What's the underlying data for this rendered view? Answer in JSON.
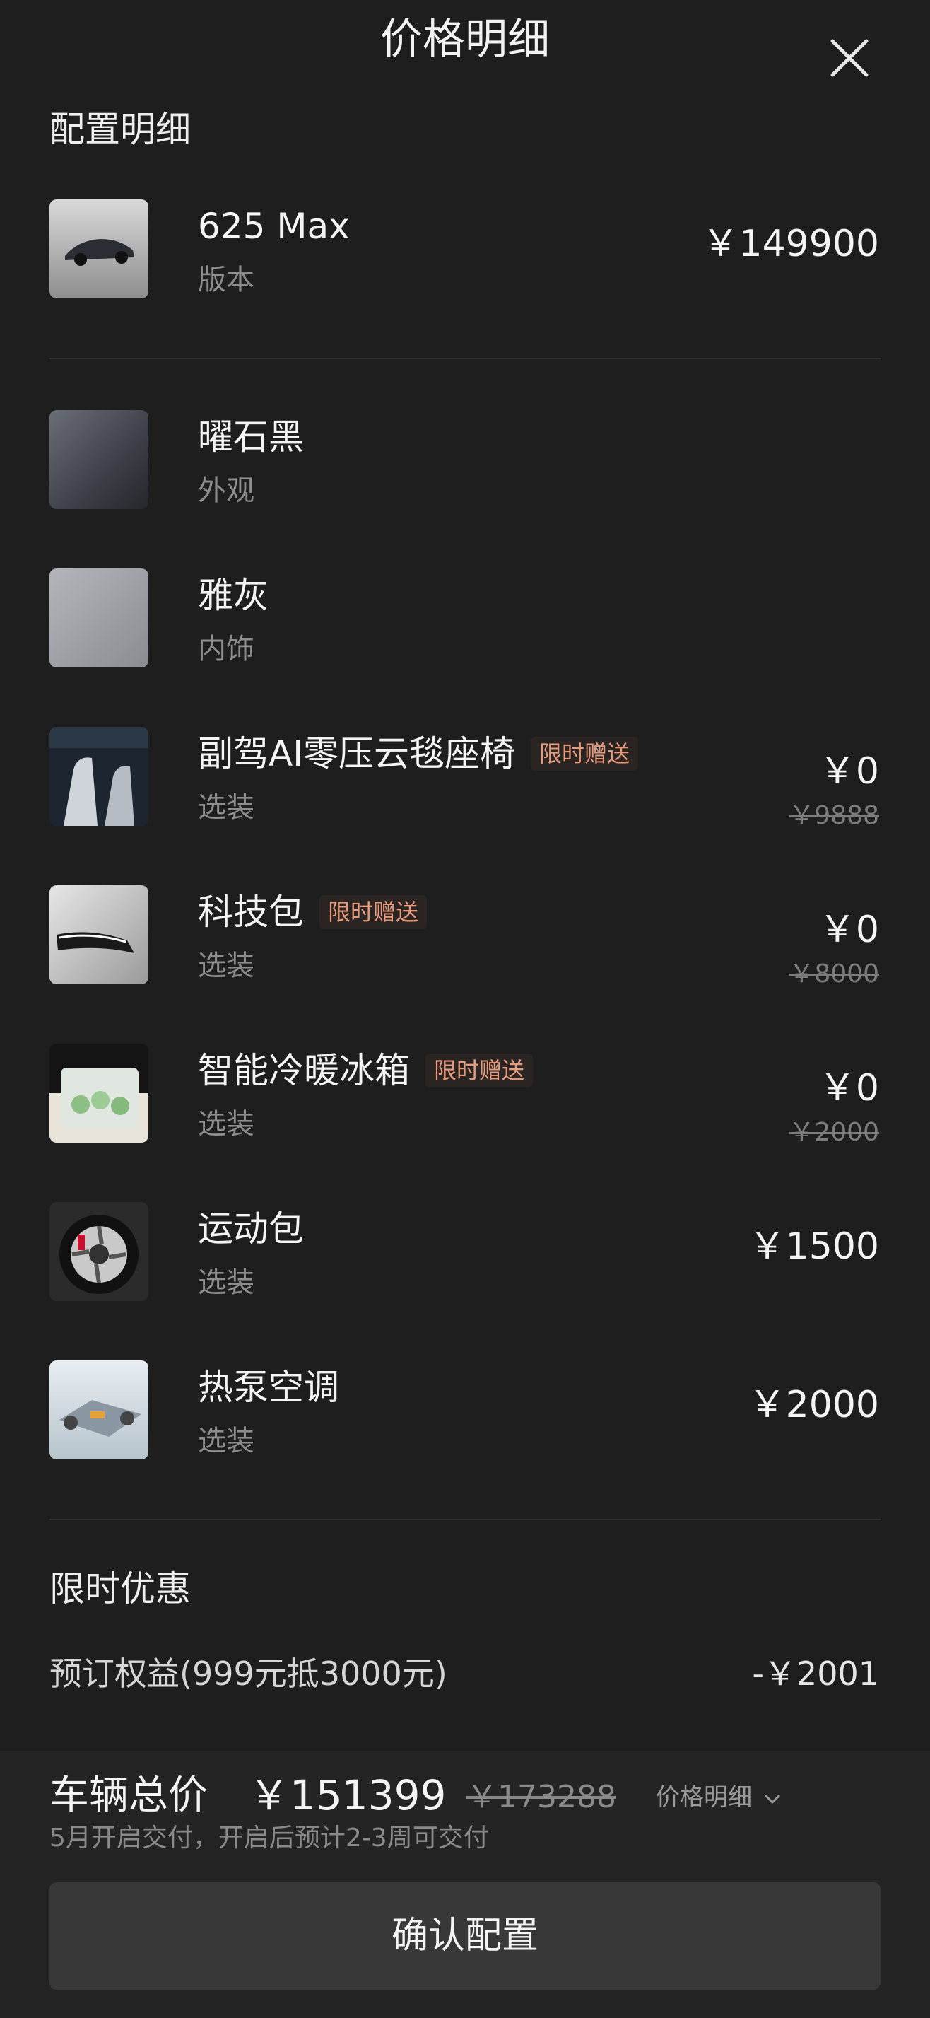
{
  "header": {
    "title": "价格明细",
    "close_icon": "close-icon"
  },
  "config": {
    "section_title": "配置明细",
    "version": {
      "name": "625 Max",
      "category": "版本",
      "price": "￥149900",
      "thumb_icon": "car-thumbnail"
    },
    "items": [
      {
        "name": "曜石黑",
        "category": "外观",
        "thumb_icon": "exterior-color-swatch"
      },
      {
        "name": "雅灰",
        "category": "内饰",
        "thumb_icon": "interior-color-swatch"
      },
      {
        "name": "副驾AI零压云毯座椅",
        "badge": "限时赠送",
        "category": "选装",
        "price": "￥0",
        "old_price": "￥9888",
        "thumb_icon": "seat-thumbnail"
      },
      {
        "name": "科技包",
        "badge": "限时赠送",
        "category": "选装",
        "price": "￥0",
        "old_price": "￥8000",
        "thumb_icon": "headlight-thumbnail"
      },
      {
        "name": "智能冷暖冰箱",
        "badge": "限时赠送",
        "category": "选装",
        "price": "￥0",
        "old_price": "￥2000",
        "thumb_icon": "fridge-thumbnail"
      },
      {
        "name": "运动包",
        "category": "选装",
        "price": "￥1500",
        "thumb_icon": "wheel-thumbnail"
      },
      {
        "name": "热泵空调",
        "category": "选装",
        "price": "￥2000",
        "thumb_icon": "chassis-thumbnail"
      }
    ]
  },
  "promo": {
    "section_title": "限时优惠",
    "items": [
      {
        "label": "预订权益(999元抵3000元)",
        "value": "-￥2001"
      }
    ]
  },
  "footer": {
    "total_label": "车辆总价",
    "total_price": "￥151399",
    "total_old_price": "￥173288",
    "price_detail_link": "价格明细",
    "delivery_note": "5月开启交付，开启后预计2-3周可交付",
    "confirm_button": "确认配置"
  },
  "colors": {
    "background": "#1e1e1e",
    "badge_text": "#e79b7c",
    "button_bg": "#383838"
  }
}
